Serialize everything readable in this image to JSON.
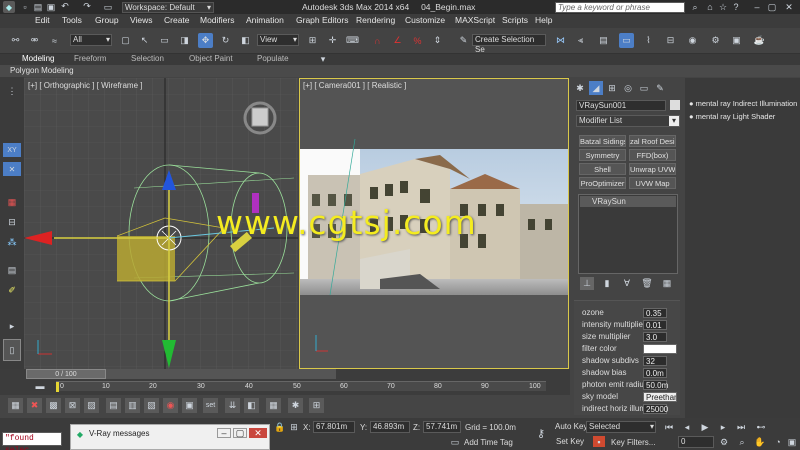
{
  "titlebar": {
    "workspace": "Workspace: Default",
    "app_title": "Autodesk 3ds Max  2014 x64",
    "file_name": "04_Begin.max",
    "search_placeholder": "Type a keyword or phrase"
  },
  "menu": [
    "Edit",
    "Tools",
    "Group",
    "Views",
    "Create",
    "Modifiers",
    "Animation",
    "Graph Editors",
    "Rendering",
    "Customize",
    "MAXScript",
    "Scripts",
    "Help"
  ],
  "toolbar": {
    "selection_filter": "All",
    "ref_coord": "View",
    "named_selection": "Create Selection Se"
  },
  "ribbon": {
    "tabs": [
      "Modeling",
      "Freeform",
      "Selection",
      "Object Paint",
      "Populate"
    ],
    "active_tab": "Modeling",
    "sub_label": "Polygon Modeling"
  },
  "viewport_left": {
    "label": "[+] [ Orthographic ] [ Wireframe ]"
  },
  "viewport_right": {
    "label": "[+] [ Camera001 ] [ Realistic ]"
  },
  "watermark": "www.cgtsj.com",
  "command_panel": {
    "object_name": "VRaySun001",
    "modifier_list": "Modifier List",
    "modifier_buttons": [
      "Batzal Sidings",
      "zal Roof Desig",
      "Symmetry",
      "FFD(box)",
      "Shell",
      "Unwrap UVW",
      "ProOptimizer",
      "UVW Map"
    ],
    "stack_item": "VRaySun",
    "params": [
      {
        "label": "ozone",
        "value": "0.35"
      },
      {
        "label": "intensity multiplier",
        "value": "0.01"
      },
      {
        "label": "size multiplier",
        "value": "3.0"
      },
      {
        "label": "filter color",
        "value": ""
      },
      {
        "label": "shadow subdivs",
        "value": "32"
      },
      {
        "label": "shadow bias",
        "value": "0.0m"
      },
      {
        "label": "photon emit radius",
        "value": "50.0m"
      },
      {
        "label": "sky model",
        "value": "Preetham et"
      },
      {
        "label": "indirect horiz illum",
        "value": "25000"
      }
    ]
  },
  "right_strip": {
    "items": [
      "mental ray Indirect Illumination",
      "mental ray Light Shader"
    ]
  },
  "timeline": {
    "frame_counter": "0 / 100",
    "ticks": [
      "0",
      "10",
      "20",
      "30",
      "40",
      "50",
      "60",
      "70",
      "80",
      "90",
      "100"
    ]
  },
  "status": {
    "maxscript_text": "\"found selec",
    "vray_window_title": "V-Ray messages",
    "x_label": "X:",
    "x_value": "67.801m",
    "y_label": "Y:",
    "y_value": "46.893m",
    "z_label": "Z:",
    "z_value": "57.741m",
    "grid": "Grid = 100.0m",
    "add_time_tag": "Add Time Tag",
    "auto_key": "Auto Key",
    "set_key": "Set Key",
    "selected": "Selected",
    "key_filters": "Key Filters...",
    "frame_field": "0"
  }
}
